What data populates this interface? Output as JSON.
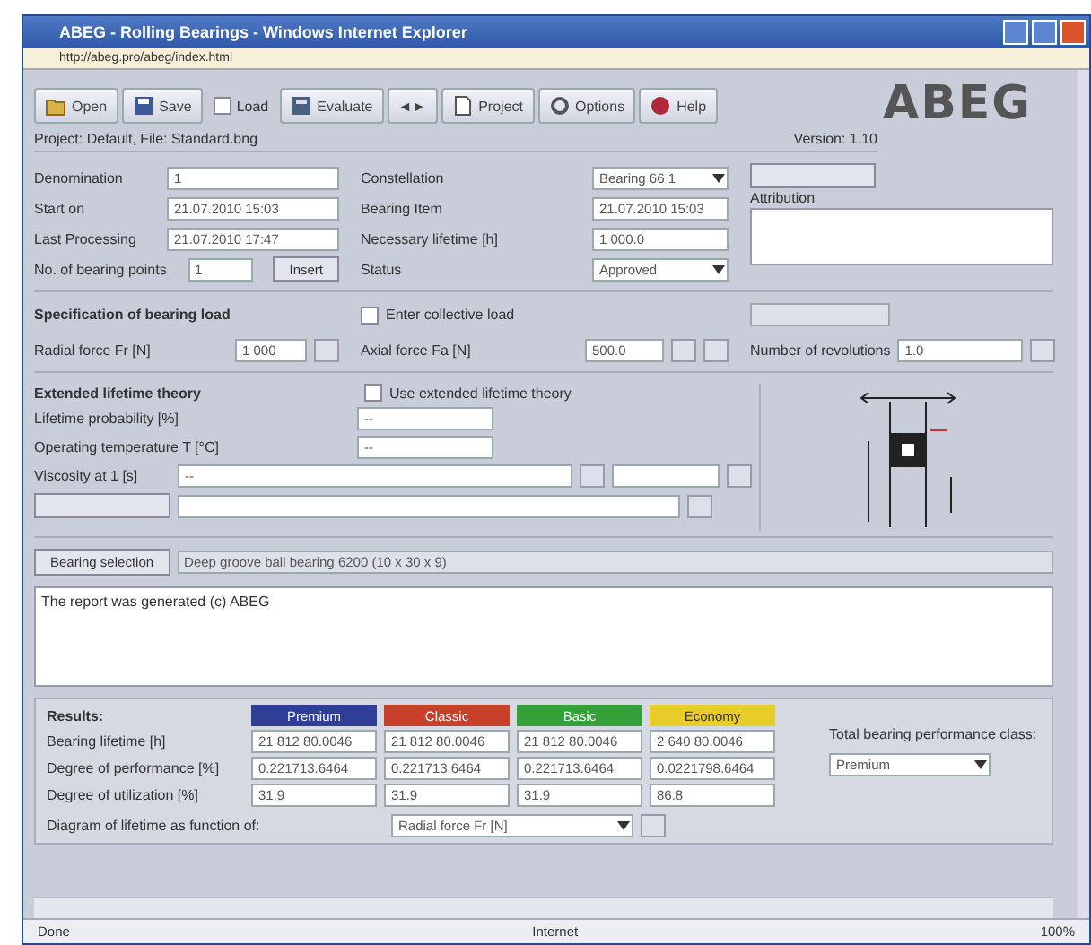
{
  "window": {
    "title": "ABEG - Rolling Bearings - Windows Internet Explorer"
  },
  "address_bar": {
    "url": "http://abeg.pro/abeg/index.html"
  },
  "toolbar": [
    {
      "kind": "button",
      "label": "Open"
    },
    {
      "kind": "button",
      "label": "Save"
    },
    {
      "kind": "checkbox",
      "label": "Load",
      "checked": false
    },
    {
      "kind": "button",
      "label": "Evaluate"
    },
    {
      "kind": "button",
      "label": "◄►"
    },
    {
      "kind": "button",
      "label": "Project"
    },
    {
      "kind": "button",
      "label": "Options"
    },
    {
      "kind": "button",
      "label": "Help"
    }
  ],
  "logo": {
    "text": "ABEG"
  },
  "project": {
    "info": "Project: Default, File: Standard.bng",
    "version": "Version: 1.10"
  },
  "general": {
    "left": [
      {
        "label": "Denomination",
        "value": "1"
      },
      {
        "label": "Start on",
        "value": "21.07.2010 15:03"
      },
      {
        "label": "Last Processing",
        "value": "21.07.2010 17:47"
      },
      {
        "label": "No. of bearing points",
        "value": "1",
        "button": "Insert"
      }
    ],
    "middle": [
      {
        "label": "Constellation",
        "value": "Bearing 66 1",
        "kind": "select"
      },
      {
        "label": "Bearing Item",
        "value": "21.07.2010 15:03",
        "kind": "text"
      },
      {
        "label": "Necessary lifetime [h]",
        "value": "1 000.0",
        "kind": "text"
      },
      {
        "label": "Status",
        "value": "Approved",
        "kind": "select"
      }
    ],
    "attribution_label": "Attribution"
  },
  "load": {
    "heading": "Specification of bearing load",
    "collective": {
      "label": "Enter collective load",
      "checked": false
    },
    "radial": {
      "label": "Radial force Fr [N]",
      "value": "1 000"
    },
    "axial": {
      "label": "Axial force Fa [N]",
      "value": "500.0"
    },
    "revolutions": {
      "label": "Number of revolutions",
      "value": "1.0"
    }
  },
  "lifetime": {
    "heading": "Extended lifetime theory",
    "extended": {
      "label": "Use extended lifetime theory",
      "checked": false
    },
    "probability": {
      "label": "Lifetime probability [%]",
      "value": "--"
    },
    "temperature": {
      "label": "Operating temperature T [°C]",
      "value": "--"
    },
    "lubricant": {
      "label": "Viscosity at 1 [s]",
      "value": "--"
    }
  },
  "bearing_selection": {
    "button": "Bearing selection",
    "value": "Deep groove ball bearing 6200 (10 x 30 x 9)"
  },
  "report": {
    "text": "The report was generated (c) ABEG"
  },
  "results": {
    "heading": "Results:",
    "columns": [
      {
        "label": "Premium",
        "color": "#2f3f97"
      },
      {
        "label": "Classic",
        "color": "#c8402a"
      },
      {
        "label": "Basic",
        "color": "#35a03a"
      },
      {
        "label": "Economy",
        "color": "#e8cc2a"
      }
    ],
    "rows": [
      {
        "label": "Bearing lifetime [h]",
        "values": [
          "21 812 80.0046",
          "21 812 80.0046",
          "21 812 80.0046",
          "2 640 80.0046"
        ]
      },
      {
        "label": "Degree of performance [%]",
        "values": [
          "0.221713.6464",
          "0.221713.6464",
          "0.221713.6464",
          "0.0221798.6464"
        ]
      },
      {
        "label": "Degree of utilization [%]",
        "values": [
          "31.9",
          "31.9",
          "31.9",
          "86.8"
        ]
      }
    ],
    "diagram": {
      "label": "Diagram of lifetime as function of:",
      "value": "Radial force Fr [N]"
    },
    "class": {
      "label": "Total bearing performance class:",
      "value": "Premium"
    }
  },
  "status_bar": {
    "left": "Done",
    "zone": "Internet",
    "zoom": "100%"
  }
}
